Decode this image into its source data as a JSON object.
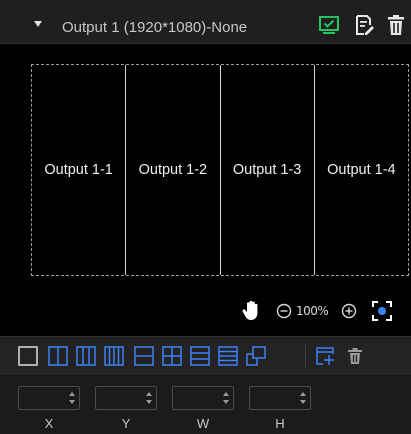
{
  "header": {
    "title": "Output 1 (1920*1080)-None",
    "icons": [
      "chevron-down-icon",
      "monitor-icon",
      "edit-icon",
      "trash-icon"
    ],
    "colors": {
      "monitor": "#22c55e",
      "icon": "#e8e8e8"
    }
  },
  "canvas": {
    "screens": [
      {
        "label": "Output 1-1"
      },
      {
        "label": "Output 1-2"
      },
      {
        "label": "Output 1-3"
      },
      {
        "label": "Output 1-4"
      }
    ],
    "zoom": {
      "value": "100%"
    },
    "icons": [
      "hand-icon",
      "zoom-out-icon",
      "zoom-in-icon",
      "fit-screen-icon"
    ],
    "colors": {
      "background": "#000000",
      "fit_accent": "#3b82f6"
    }
  },
  "toolbar": {
    "layouts": [
      {
        "name": "layout-1x1-icon"
      },
      {
        "name": "layout-2-columns-icon"
      },
      {
        "name": "layout-3-columns-icon"
      },
      {
        "name": "layout-4-columns-icon"
      },
      {
        "name": "layout-2-rows-icon"
      },
      {
        "name": "layout-2x2-grid-icon"
      },
      {
        "name": "layout-3-rows-icon"
      },
      {
        "name": "layout-4-rows-icon"
      },
      {
        "name": "layout-overlap-icon"
      }
    ],
    "actions": [
      "add-window-icon",
      "delete-icon"
    ],
    "colors": {
      "accent": "#3b82f6",
      "delete": "#9a9a9a"
    }
  },
  "coordinates": {
    "fields": [
      {
        "label": "X",
        "value": ""
      },
      {
        "label": "Y",
        "value": ""
      },
      {
        "label": "W",
        "value": ""
      },
      {
        "label": "H",
        "value": ""
      }
    ]
  }
}
